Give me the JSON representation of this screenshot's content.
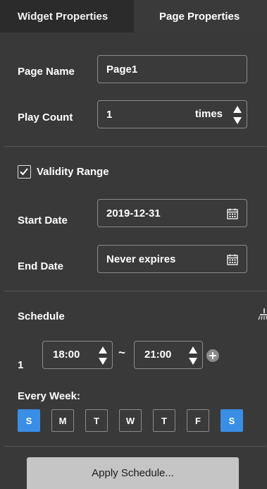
{
  "tabs": {
    "widget": "Widget Properties",
    "page": "Page Properties"
  },
  "page_name": {
    "label": "Page Name",
    "value": "Page1"
  },
  "play_count": {
    "label": "Play Count",
    "value": "1",
    "unit": "times"
  },
  "validity": {
    "label": "Validity Range",
    "checked": true
  },
  "start_date": {
    "label": "Start Date",
    "value": "2019-12-31"
  },
  "end_date": {
    "label": "End Date",
    "value": "Never expires"
  },
  "schedule": {
    "label": "Schedule",
    "row_index": "1",
    "start_time": "18:00",
    "separator": "~",
    "end_time": "21:00"
  },
  "every_week": {
    "label": "Every Week:",
    "days": [
      {
        "label": "S",
        "selected": true
      },
      {
        "label": "M",
        "selected": false
      },
      {
        "label": "T",
        "selected": false
      },
      {
        "label": "W",
        "selected": false
      },
      {
        "label": "T",
        "selected": false
      },
      {
        "label": "F",
        "selected": false
      },
      {
        "label": "S",
        "selected": true
      }
    ]
  },
  "apply_button": "Apply Schedule...",
  "colors": {
    "panel": "#393939",
    "accent": "#3a8ee6",
    "button": "#c5c5c5"
  }
}
